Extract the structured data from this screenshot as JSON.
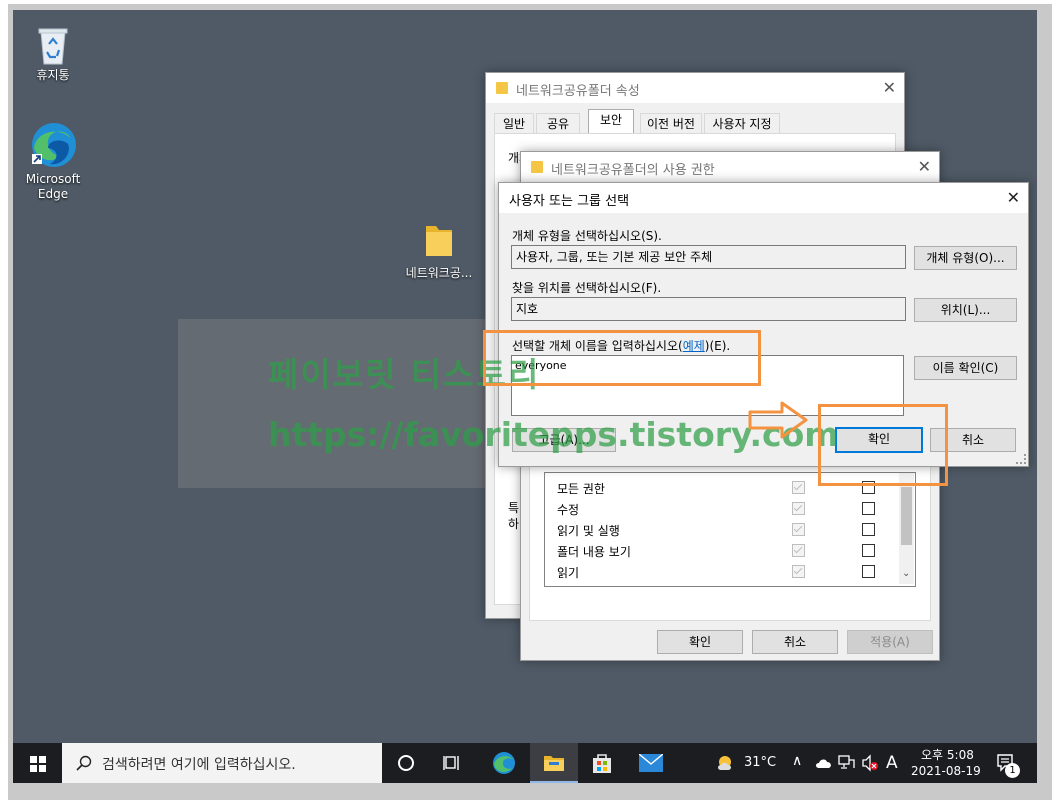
{
  "desktop": {
    "recycle_bin_label": "휴지통",
    "edge_label": "Microsoft\nEdge",
    "edge_label_1": "Microsoft",
    "edge_label_2": "Edge",
    "folder_label": "네트워크공..."
  },
  "watermark": {
    "line1": "페이보릿 티스토리",
    "line2": "https://favoritepps.tistory.com"
  },
  "properties_window": {
    "title": "네트워크공유폴더 속성",
    "tabs": [
      "일반",
      "공유",
      "보안",
      "이전 버전",
      "사용자 지정"
    ],
    "active_tab": "보안",
    "partial_label_top": "개체 이름",
    "partial_label_1": "특",
    "partial_label_2": "하"
  },
  "permissions_window": {
    "title": "네트워크공유폴더의 사용 권한",
    "permissions": [
      {
        "name": "모든 권한",
        "allow": true,
        "deny": false
      },
      {
        "name": "수정",
        "allow": true,
        "deny": false
      },
      {
        "name": "읽기 및 실행",
        "allow": true,
        "deny": false
      },
      {
        "name": "폴더 내용 보기",
        "allow": true,
        "deny": false
      },
      {
        "name": "읽기",
        "allow": true,
        "deny": false
      }
    ],
    "ok_label": "확인",
    "cancel_label": "취소",
    "apply_label": "적용(A)"
  },
  "select_dialog": {
    "title": "사용자 또는 그룹 선택",
    "object_type_label": "개체 유형을 선택하십시오(S).",
    "object_type_value": "사용자, 그룹, 또는 기본 제공 보안 주체",
    "object_type_button": "개체 유형(O)...",
    "location_label": "찾을 위치를 선택하십시오(F).",
    "location_value": "지호",
    "location_button": "위치(L)...",
    "enter_names_label_pre": "선택할 개체 이름을 입력하십시오(",
    "enter_names_link": "예제",
    "enter_names_label_post": ")(E).",
    "names_value": "everyone",
    "check_names_button": "이름 확인(C)",
    "advanced_button": "고급(A)...",
    "ok_label": "확인",
    "cancel_label": "취소"
  },
  "taskbar": {
    "search_placeholder": "검색하려면 여기에 입력하십시오.",
    "weather": "31°C",
    "ime": "A",
    "time": "오후 5:08",
    "date": "2021-08-19",
    "notification_count": "1"
  },
  "colors": {
    "desktop": "#4f5a66",
    "taskbar": "#1c1d21",
    "highlight": "#f39342",
    "accent": "#0078d7"
  }
}
